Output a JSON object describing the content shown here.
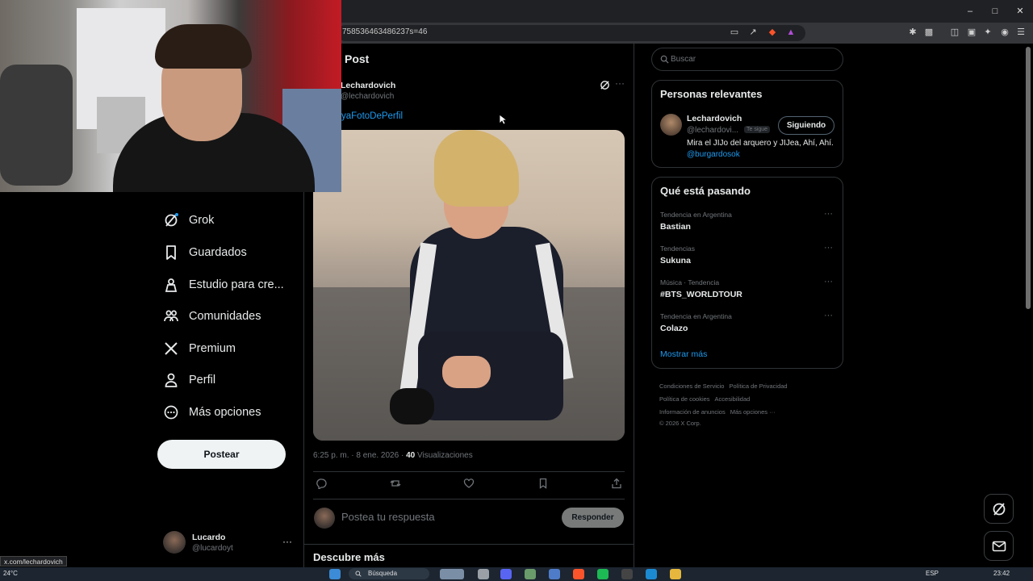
{
  "browser": {
    "url": "758536463486237s=46",
    "window_controls": [
      "minimize-icon",
      "maximize-icon",
      "close-icon"
    ]
  },
  "nav": {
    "items": [
      {
        "label": "Grok",
        "icon": "grok-icon"
      },
      {
        "label": "Guardados",
        "icon": "bookmark-icon"
      },
      {
        "label": "Estudio para cre...",
        "icon": "creator-studio-icon"
      },
      {
        "label": "Comunidades",
        "icon": "communities-icon"
      },
      {
        "label": "Premium",
        "icon": "x-logo-icon"
      },
      {
        "label": "Perfil",
        "icon": "profile-icon"
      },
      {
        "label": "Más opciones",
        "icon": "more-options-icon"
      }
    ],
    "post_button": "Postear",
    "account": {
      "name": "Lucardo",
      "handle": "@lucardoyt",
      "more": "···"
    }
  },
  "status_bar_url": "x.com/lechardovich",
  "post": {
    "header": "Post",
    "author_name": "Lechardovich",
    "author_handle": "@lechardovich",
    "hashtag": "yaFotoDePerfil",
    "more": "···",
    "timestamp": "6:25 p. m. · 8 ene. 2026 · ",
    "views_count": "40",
    "views_label": " Visualizaciones",
    "reply_placeholder": "Postea tu respuesta",
    "reply_button": "Responder",
    "discover": "Descubre más"
  },
  "sidebar": {
    "search_placeholder": "Buscar",
    "relevant": {
      "title": "Personas relevantes",
      "name": "Lechardovich",
      "handle": "@lechardovi...",
      "badge": "Te sigue",
      "follow_button": "Siguiendo",
      "bio": "Mira el JIJo del arquero y JIJea, Ahí, Ahí.",
      "bio_link": "@burgardosok"
    },
    "trends": {
      "title": "Qué está pasando",
      "items": [
        {
          "context": "Tendencia en Argentina",
          "name": "Bastian"
        },
        {
          "context": "Tendencias",
          "name": "Sukuna"
        },
        {
          "context": "Música · Tendencia",
          "name": "#BTS_WORLDTOUR"
        },
        {
          "context": "Tendencia en Argentina",
          "name": "Colazo"
        }
      ],
      "more": "···",
      "show_more": "Mostrar más"
    },
    "footer": [
      "Condiciones de Servicio",
      "Política de Privacidad",
      "Política de cookies",
      "Accesibilidad",
      "Información de anuncios",
      "Más opciones ···",
      "© 2026 X Corp."
    ]
  },
  "taskbar": {
    "weather": "24°C",
    "search": "Búsqueda",
    "lang": "ESP",
    "time": "23:42"
  }
}
